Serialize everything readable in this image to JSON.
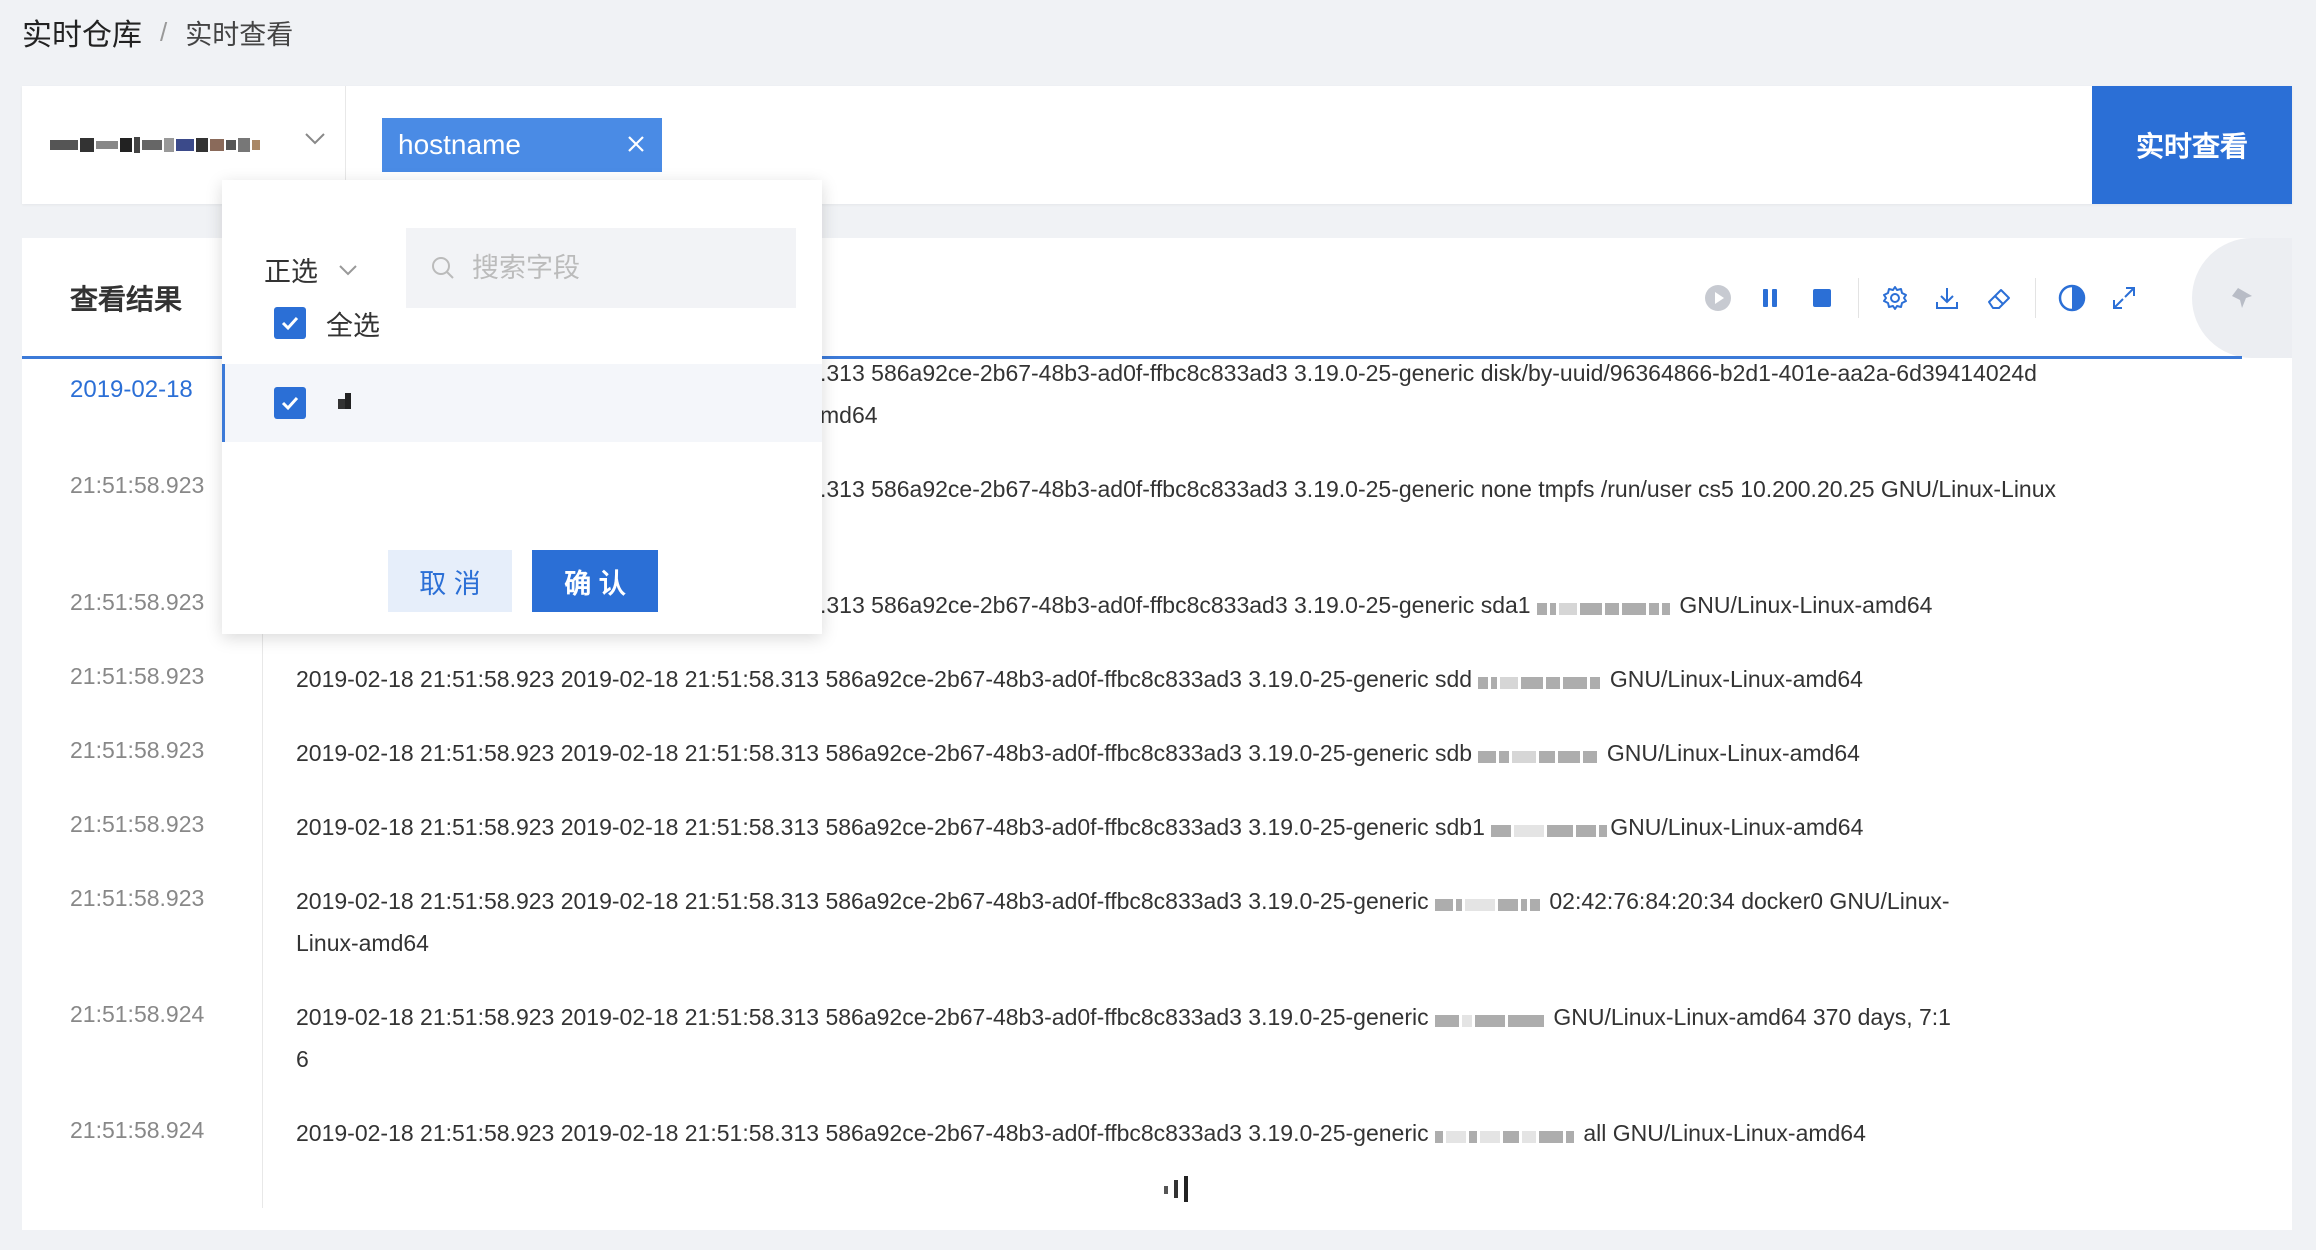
{
  "breadcrumb": {
    "root": "实时仓库",
    "separator": "/",
    "current": "实时查看"
  },
  "query": {
    "field_tag": "hostname",
    "submit_label": "实时查看",
    "colors": {
      "primary": "#2b6fd6",
      "tag": "#4a8be5"
    }
  },
  "results": {
    "title": "查看结果",
    "first_date": "2019-02-18",
    "times": [
      "21:51:58.923",
      "21:51:58.923",
      "21:51:58.923",
      "21:51:58.923",
      "21:51:58.923",
      "21:51:58.923",
      "21:51:58.924",
      "21:51:58.924"
    ],
    "lines": [
      {
        "text": ".313 586a92ce-2b67-48b3-ad0f-ffbc8c833ad3 3.19.0-25-generic disk/by-uuid/96364866-b2d1-401e-aa2a-6d39414024d"
      },
      {
        "text": "md64"
      },
      {
        "text": ".313 586a92ce-2b67-48b3-ad0f-ffbc8c833ad3 3.19.0-25-generic none tmpfs /run/user cs5 10.200.20.25 GNU/Linux-Linux"
      },
      {
        "text": ".313 586a92ce-2b67-48b3-ad0f-ffbc8c833ad3 3.19.0-25-generic sda1",
        "tail": "GNU/Linux-Linux-amd64"
      },
      {
        "text": "2019-02-18 21:51:58.923 2019-02-18 21:51:58.313 586a92ce-2b67-48b3-ad0f-ffbc8c833ad3 3.19.0-25-generic sdd",
        "tail": "GNU/Linux-Linux-amd64"
      },
      {
        "text": "2019-02-18 21:51:58.923 2019-02-18 21:51:58.313 586a92ce-2b67-48b3-ad0f-ffbc8c833ad3 3.19.0-25-generic sdb",
        "tail": "GNU/Linux-Linux-amd64"
      },
      {
        "text": "2019-02-18 21:51:58.923 2019-02-18 21:51:58.313 586a92ce-2b67-48b3-ad0f-ffbc8c833ad3 3.19.0-25-generic sdb1",
        "tail": "GNU/Linux-Linux-amd64"
      },
      {
        "text": "2019-02-18 21:51:58.923 2019-02-18 21:51:58.313 586a92ce-2b67-48b3-ad0f-ffbc8c833ad3 3.19.0-25-generic",
        "tail": "02:42:76:84:20:34 docker0 GNU/Linux-"
      },
      {
        "text": "Linux-amd64"
      },
      {
        "text": "2019-02-18 21:51:58.923 2019-02-18 21:51:58.313 586a92ce-2b67-48b3-ad0f-ffbc8c833ad3 3.19.0-25-generic",
        "tail": "GNU/Linux-Linux-amd64 370 days, 7:1"
      },
      {
        "text": "6"
      },
      {
        "text": "2019-02-18 21:51:58.923 2019-02-18 21:51:58.313 586a92ce-2b67-48b3-ad0f-ffbc8c833ad3 3.19.0-25-generic",
        "tail": "all GNU/Linux-Linux-amd64"
      }
    ]
  },
  "dropdown": {
    "mode": "正选",
    "search_placeholder": "搜索字段",
    "select_all": "全选",
    "cancel": "取 消",
    "confirm": "确 认"
  }
}
